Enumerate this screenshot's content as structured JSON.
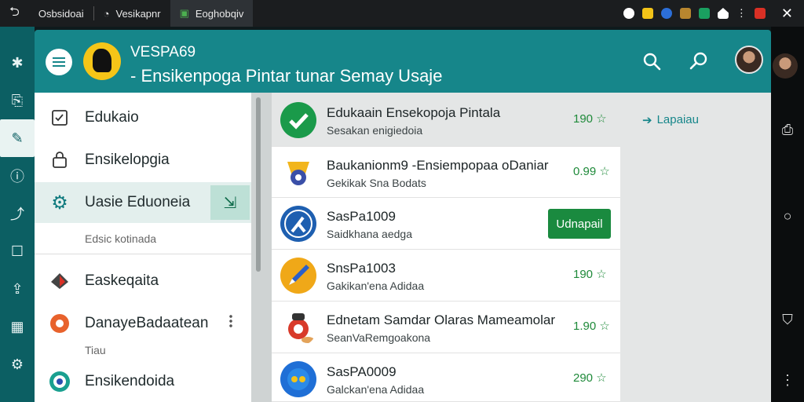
{
  "browser": {
    "tabs": [
      {
        "label": "Osbsidoai"
      },
      {
        "label": "Vesikapnr"
      },
      {
        "label": "Eoghobqiv"
      }
    ],
    "close_label": "✕"
  },
  "header": {
    "title": "VESPA69",
    "subtitle": "- Ensikenpoga Pintar tunar Semay Usaje"
  },
  "drawer": {
    "items": [
      {
        "label": "Edukaio"
      },
      {
        "label": "Ensikelopgia"
      },
      {
        "label": "Uasie Eduoneia"
      },
      {
        "label": "Easkeqaita"
      },
      {
        "label": "DanayeBadaatean"
      },
      {
        "label": "Ensikendoida"
      }
    ],
    "caption1": "Edsic kotinada",
    "caption2": "Tiau"
  },
  "list": {
    "top_link": "Lapaiau",
    "rows": [
      {
        "title": "Edukaain Ensekopoja Pintala",
        "subtitle": "Sesakan enigiedoia",
        "rating": "190 ☆",
        "icon_color": "#1a9a4a"
      },
      {
        "title": "Baukanionm9 -Ensiempopaa oDaniar",
        "subtitle": "Gekikak Sna Bodats",
        "rating": "0.99 ☆",
        "icon_color": "#f2b51c"
      },
      {
        "title": "SasPa1009",
        "subtitle": "Saidkhana aedga",
        "button": "Udnapail",
        "icon_color": "#1e5fb0"
      },
      {
        "title": "SnsPa1003",
        "subtitle": "Gakikan'ena Adidaa",
        "rating": "190 ☆",
        "icon_color": "#f0a818"
      },
      {
        "title": "Ednetam Samdar Olaras Mameamolar",
        "subtitle": "SeanVaRemgoakona",
        "rating": "1.90 ☆",
        "icon_color": "#d83a2a"
      },
      {
        "title": "SasPA0009",
        "subtitle": "Galckan'ena Adidaa",
        "rating": "290 ☆",
        "icon_color": "#1f6fd6"
      }
    ]
  }
}
